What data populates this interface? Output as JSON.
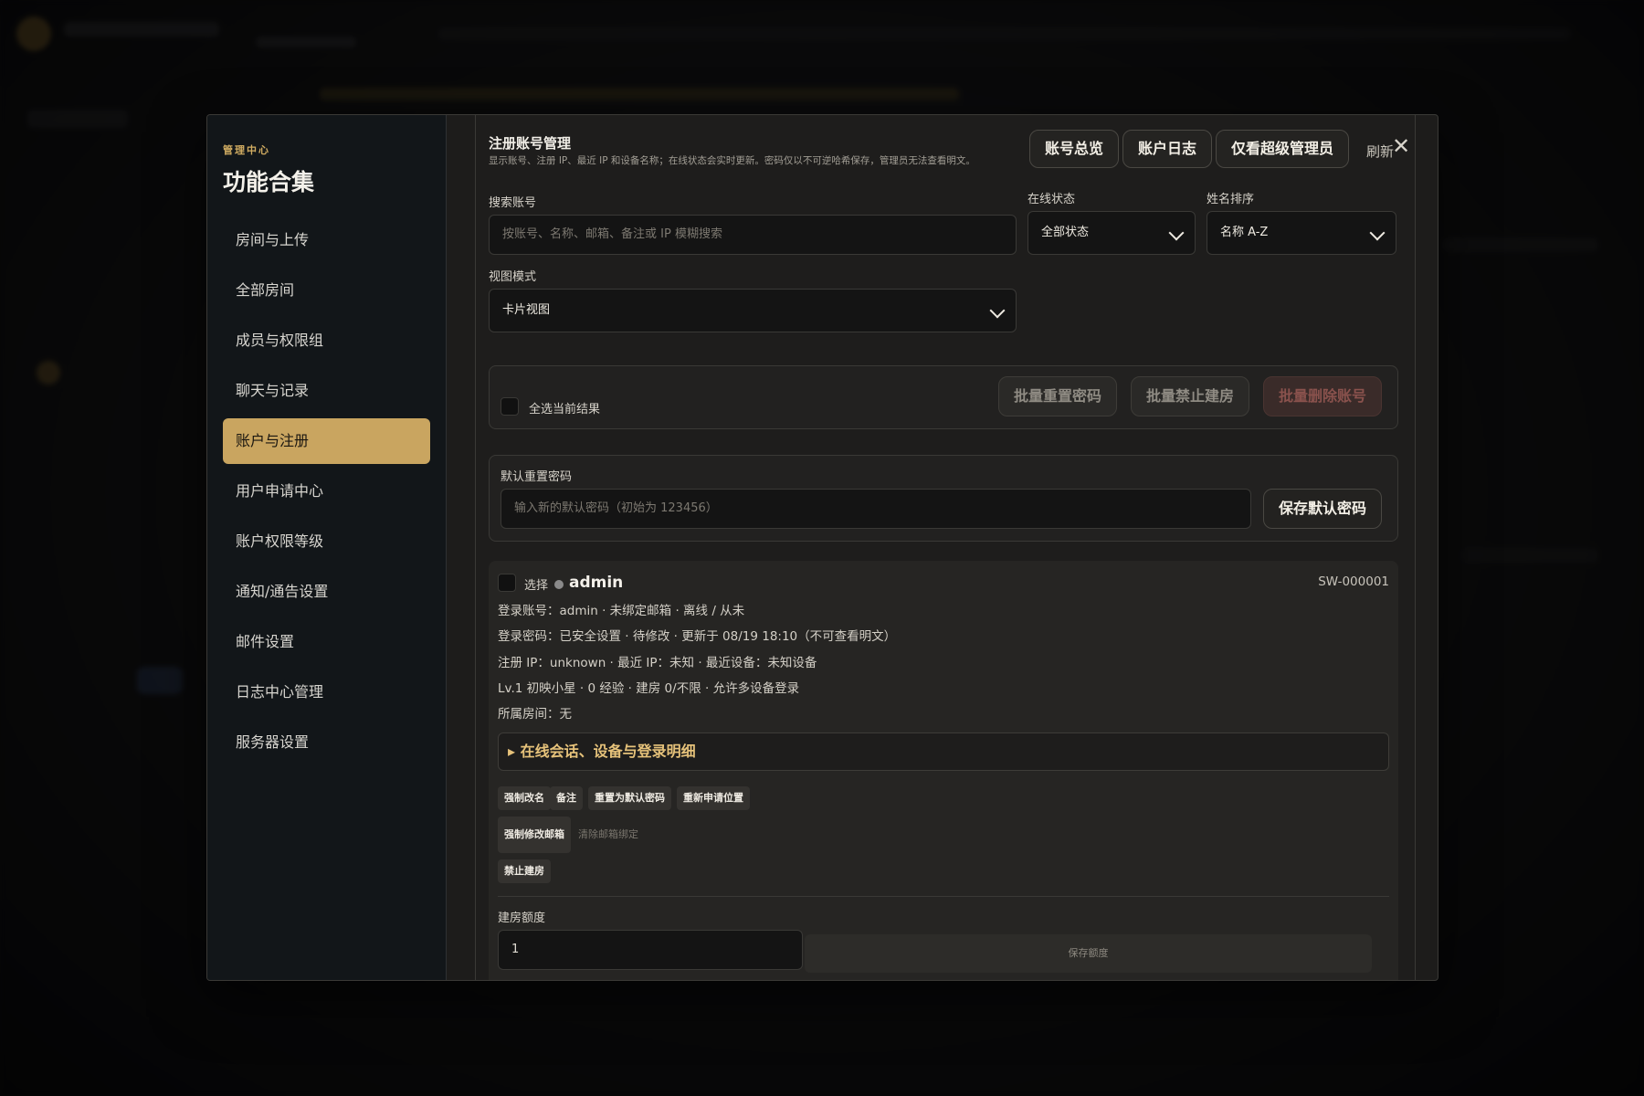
{
  "sidebar": {
    "kicker": "管理中心",
    "title": "功能合集",
    "items": [
      {
        "label": "房间与上传"
      },
      {
        "label": "全部房间"
      },
      {
        "label": "成员与权限组"
      },
      {
        "label": "聊天与记录"
      },
      {
        "label": "账户与注册",
        "active": true
      },
      {
        "label": "用户申请中心"
      },
      {
        "label": "账户权限等级"
      },
      {
        "label": "通知/通告设置"
      },
      {
        "label": "邮件设置"
      },
      {
        "label": "日志中心管理"
      },
      {
        "label": "服务器设置"
      }
    ]
  },
  "header": {
    "title": "注册账号管理",
    "description": "显示账号、注册 IP、最近 IP 和设备名称；在线状态会实时更新。密码仅以不可逆哈希保存，管理员无法查看明文。",
    "tabs": [
      "账号总览",
      "账户日志",
      "仅看超级管理员"
    ],
    "refresh_label": "刷新",
    "close_icon": "✕"
  },
  "filters": {
    "search_label": "搜索账号",
    "search_placeholder": "按账号、名称、邮箱、备注或 IP 模糊搜索",
    "status_label": "在线状态",
    "status_value": "全部状态",
    "sort_label": "姓名排序",
    "sort_value": "名称 A-Z",
    "view_label": "视图模式",
    "view_value": "卡片视图"
  },
  "bulk": {
    "select_all_label": "全选当前结果",
    "reset_password": "批量重置密码",
    "ban_create": "批量禁止建房",
    "delete": "批量删除账号"
  },
  "default_password": {
    "label": "默认重置密码",
    "placeholder": "输入新的默认密码（初始为 123456）",
    "save_label": "保存默认密码"
  },
  "user": {
    "select_label": "选择",
    "name": "admin",
    "id": "SW-000001",
    "line1": "登录账号：admin · 未绑定邮箱 · 离线 / 从未",
    "line2": "登录密码：已安全设置 · 待修改 · 更新于 08/19 18:10（不可查看明文）",
    "line3": "注册 IP：unknown · 最近 IP：未知 · 最近设备：未知设备",
    "line4": "Lv.1 初映小星 · 0 经验 · 建房 0/不限 · 允许多设备登录",
    "line5": "所属房间：无",
    "details_label": "▸ 在线会话、设备与登录明细",
    "actions": {
      "rename": "强制改名",
      "note": "备注",
      "reset_default": "重置为默认密码",
      "reapply": "重新申请位置",
      "change_email": "强制修改邮箱",
      "clear_email": "清除邮箱绑定",
      "ban_create": "禁止建房"
    },
    "quota_label": "建房额度",
    "quota_value": "1",
    "quota_save": "保存额度"
  },
  "colors": {
    "accent": "#c9a560",
    "accent_text": "#d2ad62",
    "danger": "#8a524d"
  }
}
